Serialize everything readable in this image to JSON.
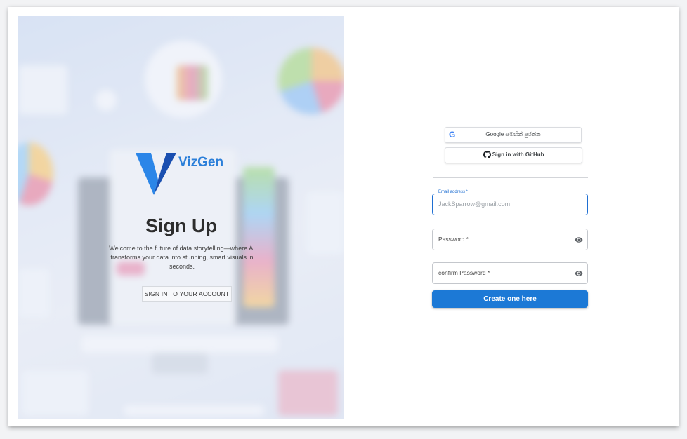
{
  "brand": {
    "name": "VizGen"
  },
  "hero": {
    "title": "Sign Up",
    "tagline": "Welcome to the future of data storytelling—where AI transforms your data into stunning, smart visuals in seconds.",
    "signin_button": "SIGN IN TO YOUR ACCOUNT"
  },
  "oauth": {
    "google_label": "Google සමඟින් පුරන්න",
    "github_label": "Sign in with GitHub"
  },
  "form": {
    "email": {
      "label": "Email address *",
      "placeholder": "JackSparrow@gmail.com"
    },
    "password": {
      "label": "Password *"
    },
    "confirm_password": {
      "label": "confirm Password *"
    },
    "submit_label": "Create one here"
  },
  "icons": {
    "google": "google-g-icon",
    "github": "github-icon",
    "visibility": "eye-icon"
  },
  "colors": {
    "accent": "#1c79d6",
    "brand_text": "#2b7fd9",
    "logo_light": "#2b86e8",
    "logo_dark": "#1a4fb0"
  }
}
